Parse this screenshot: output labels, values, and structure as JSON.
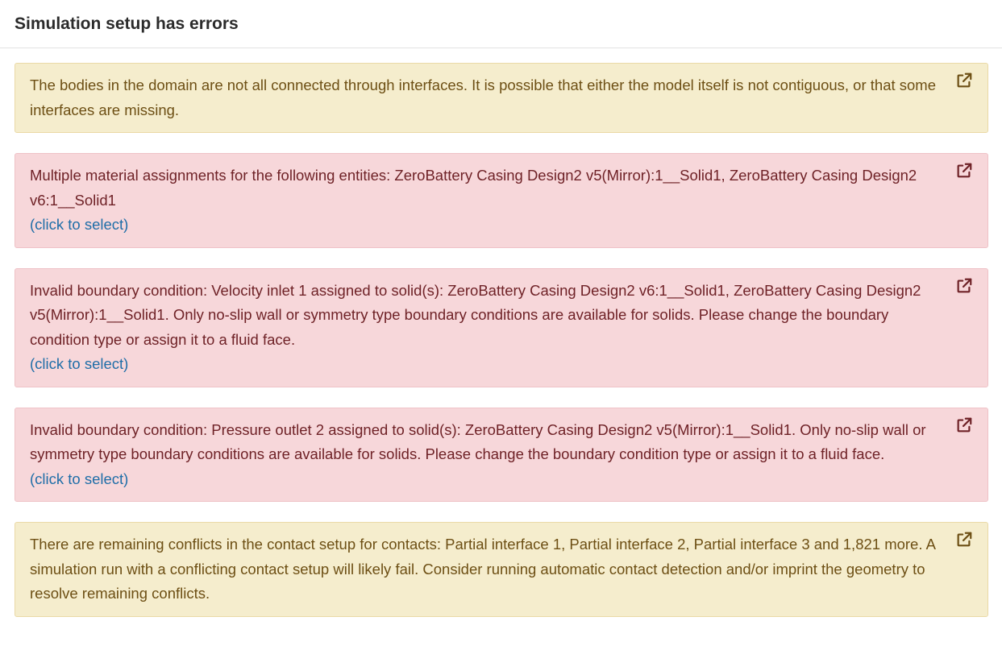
{
  "header": {
    "title": "Simulation setup has errors"
  },
  "alerts": [
    {
      "type": "warning",
      "message": "The bodies in the domain are not all connected through interfaces. It is possible that either the model itself is not contiguous, or that some interfaces are missing.",
      "link": ""
    },
    {
      "type": "error",
      "message": "Multiple material assignments for the following entities: ZeroBattery Casing Design2 v5(Mirror):1__Solid1, ZeroBattery Casing Design2 v6:1__Solid1",
      "link": "(click to select)"
    },
    {
      "type": "error",
      "message": "Invalid boundary condition: Velocity inlet 1 assigned to solid(s): ZeroBattery Casing Design2 v6:1__Solid1, ZeroBattery Casing Design2 v5(Mirror):1__Solid1. Only no-slip wall or symmetry type boundary conditions are available for solids. Please change the boundary condition type or assign it to a fluid face.",
      "link": "(click to select)"
    },
    {
      "type": "error",
      "message": "Invalid boundary condition: Pressure outlet 2 assigned to solid(s): ZeroBattery Casing Design2 v5(Mirror):1__Solid1. Only no-slip wall or symmetry type boundary conditions are available for solids. Please change the boundary condition type or assign it to a fluid face.",
      "link": "(click to select)"
    },
    {
      "type": "warning",
      "message": "There are remaining conflicts in the contact setup for contacts: Partial interface 1, Partial interface 2, Partial interface 3 and 1,821 more. A simulation run with a conflicting contact setup will likely fail. Consider running automatic contact detection and/or imprint the geometry to resolve remaining conflicts.",
      "link": ""
    }
  ],
  "icons": {
    "external_link": "external-link-icon"
  },
  "colors": {
    "warning_bg": "#f5edcd",
    "warning_text": "#6d4f14",
    "error_bg": "#f7d7da",
    "error_text": "#6f2227",
    "link": "#1f6ea8"
  }
}
